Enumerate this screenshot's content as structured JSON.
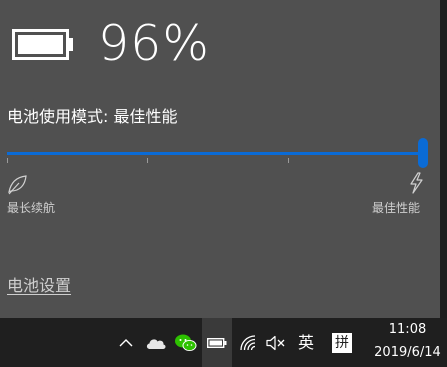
{
  "flyout": {
    "battery_icon": "battery-full-icon",
    "percent_text": "96%",
    "battery_level": 0.96,
    "mode_label": "电池使用模式: 最佳性能",
    "slider": {
      "value": 1.0,
      "ticks": 3,
      "accent_color": "#0a6bd6"
    },
    "left_label": "最长续航",
    "left_icon": "leaf-icon",
    "right_label": "最佳性能",
    "right_icon": "lightning-bolt-icon",
    "settings_link": "电池设置"
  },
  "taskbar": {
    "icons": [
      "chevron-up-icon",
      "onedrive-cloud-icon",
      "wechat-icon",
      "battery-icon",
      "wifi-icon",
      "speaker-muted-icon"
    ],
    "ime_language": "英",
    "ime_mode": "拼",
    "clock": {
      "time": "11:08",
      "date": "2019/6/14"
    }
  }
}
